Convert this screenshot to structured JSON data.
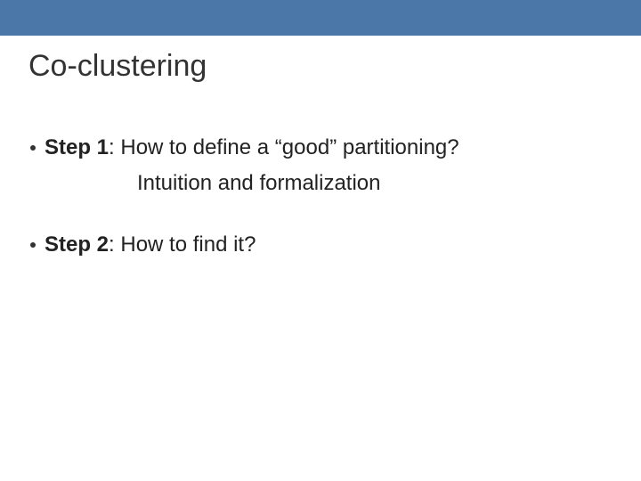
{
  "slide": {
    "title": "Co-clustering",
    "bullets": [
      {
        "label": "Step 1",
        "text": ": How to define a “good” partitioning?",
        "sub": "Intuition and formalization"
      },
      {
        "label": "Step 2",
        "text": ": How to find it?",
        "sub": ""
      }
    ]
  }
}
